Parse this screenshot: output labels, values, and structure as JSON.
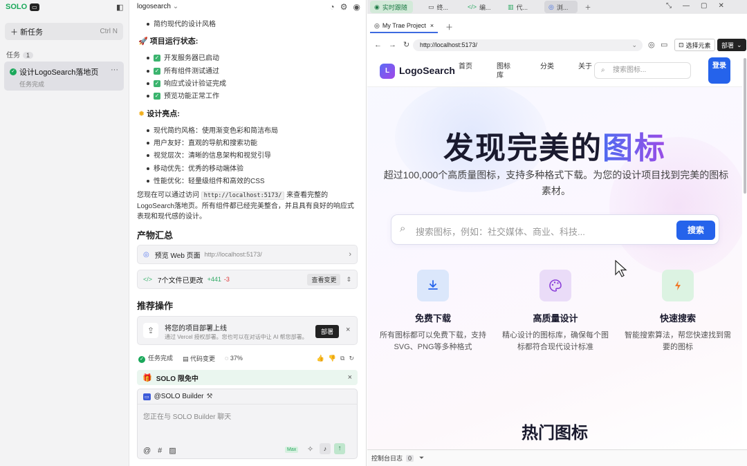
{
  "sidebar": {
    "logo": "SOLO",
    "new_task": "新任务",
    "new_task_shortcut": "Ctrl N",
    "tasks_label": "任务",
    "tasks_count": "1",
    "task_title": "设计LogoSearch落地页",
    "task_status": "任务完成"
  },
  "chat": {
    "project": "logosearch",
    "top_bullet": "简约现代的设计风格",
    "status_title": "项目运行状态:",
    "status_items": [
      "开发服务器已启动",
      "所有组件测试通过",
      "响应式设计验证完成",
      "预览功能正常工作"
    ],
    "highlights_title": "设计亮点:",
    "highlights": [
      "现代简约风格：使用渐变色彩和简洁布局",
      "用户友好：直观的导航和搜索功能",
      "视觉层次：清晰的信息架构和视觉引导",
      "移动优先：优秀的移动端体验",
      "性能优化：轻量级组件和高效的CSS"
    ],
    "summary_pre": "您现在可以通过访问",
    "summary_code": "http://localhost:5173/",
    "summary_post": "来查看完整的LogoSearch落地页。所有组件都已经完美整合，并且具有良好的响应式表现和现代感的设计。",
    "artifacts_title": "产物汇总",
    "preview_label": "预览 Web 页面",
    "preview_url": "http://localhost:5173/",
    "files_label": "7个文件已更改",
    "files_add": "+441",
    "files_del": "-3",
    "view_changes": "查看变更",
    "recommend_title": "推荐操作",
    "deploy_title": "将您的项目部署上线",
    "deploy_desc": "通过 Vercel 授权部署。您也可以在对话中让 AI 帮您部署。",
    "deploy_btn": "部署",
    "stat_done": "任务完成",
    "stat_changes": "代码变更",
    "stat_pct": "37%",
    "promo": "SOLO 限免中",
    "builder_label": "@SOLO Builder",
    "composer_placeholder": "您正在与 SOLO Builder 聊天",
    "max_badge": "Max"
  },
  "browser": {
    "tabs": [
      "实时跟随",
      "终...",
      "编...",
      "代...",
      "浏..."
    ],
    "page_tab": "My Trae Project",
    "url": "http://localhost:5173/",
    "select_element": "选择元素",
    "deploy": "部署",
    "console": "控制台日志",
    "console_count": "0"
  },
  "site": {
    "logo_letter": "L",
    "logo": "LogoSearch",
    "nav": [
      "首页",
      "图标库",
      "分类",
      "关于"
    ],
    "search_placeholder": "搜索图标...",
    "login": "登录",
    "hero_main": "发现完美的",
    "hero_highlight": "图标",
    "hero_sub": "超过100,000个高质量图标，支持多种格式下载。为您的设计项目找到完美的图标素材。",
    "big_search_placeholder": "搜索图标，例如：社交媒体、商业、科技...",
    "big_search_btn": "搜索",
    "features": [
      {
        "title": "免费下载",
        "desc": "所有图标都可以免费下载，支持SVG、PNG等多种格式"
      },
      {
        "title": "高质量设计",
        "desc": "精心设计的图标库，确保每个图标都符合现代设计标准"
      },
      {
        "title": "快速搜索",
        "desc": "智能搜索算法，帮您快速找到需要的图标"
      }
    ],
    "hot_title": "热门图标"
  }
}
